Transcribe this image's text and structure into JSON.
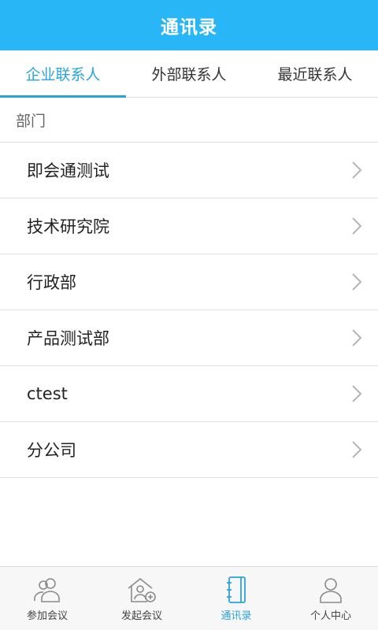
{
  "header": {
    "title": "通讯录"
  },
  "tabs": [
    {
      "label": "企业联系人",
      "active": true
    },
    {
      "label": "外部联系人",
      "active": false
    },
    {
      "label": "最近联系人",
      "active": false
    }
  ],
  "section": {
    "label": "部门"
  },
  "departments": [
    {
      "name": "即会通测试"
    },
    {
      "name": "技术研究院"
    },
    {
      "name": "行政部"
    },
    {
      "name": "产品测试部"
    },
    {
      "name": "ctest"
    },
    {
      "name": "分公司"
    }
  ],
  "bottom_nav": [
    {
      "label": "参加会议",
      "icon": "join-meeting-icon",
      "active": false
    },
    {
      "label": "发起会议",
      "icon": "start-meeting-icon",
      "active": false
    },
    {
      "label": "通讯录",
      "icon": "address-book-icon",
      "active": true
    },
    {
      "label": "个人中心",
      "icon": "profile-icon",
      "active": false
    }
  ],
  "colors": {
    "header_bg": "#29b6f6",
    "accent": "#29a3dd",
    "divider": "#e0e0e0"
  }
}
